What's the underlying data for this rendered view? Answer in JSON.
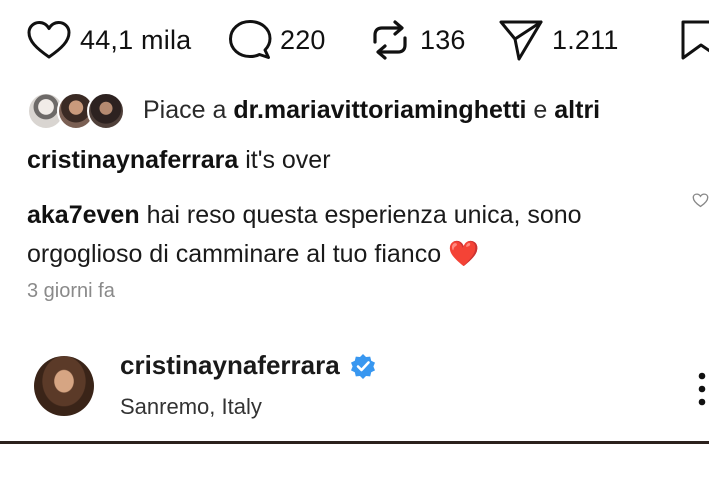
{
  "actions": {
    "like_count": "44,1 mila",
    "comment_count": "220",
    "repost_count": "136",
    "share_count": "1.211",
    "icons": [
      "heart-icon",
      "comment-bubble-icon",
      "repost-icon",
      "share-icon",
      "bookmark-icon"
    ]
  },
  "likes": {
    "prefix": "Piace a",
    "user": "dr.mariavittoriaminghetti",
    "conjunction": "e",
    "others": "altri"
  },
  "caption": {
    "username": "cristinaynaferrara",
    "text": "it's over"
  },
  "comment": {
    "username": "aka7even",
    "text": "hai reso questa esperienza unica, sono orgoglioso di camminare al tuo fianco",
    "emoji": "❤️",
    "timestamp": "3 giorni fa"
  },
  "profile": {
    "username": "cristinaynaferrara",
    "location": "Sanremo, Italy",
    "verified": true,
    "verified_color": "#3897f0"
  }
}
